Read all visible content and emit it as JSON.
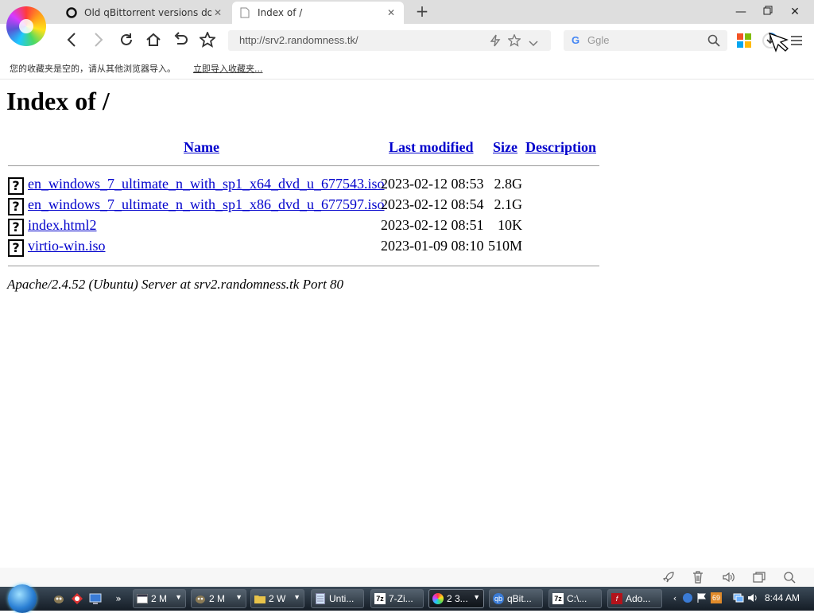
{
  "browser": {
    "tabs": [
      {
        "title": "Old qBittorrent versions down",
        "active": false
      },
      {
        "title": "Index of /",
        "active": true
      }
    ],
    "address_url": "http://srv2.randomness.tk/",
    "search_placeholder": "Ggle",
    "favorites_bar": {
      "message": "您的收藏夹是空的，请从其他浏览器导入。",
      "import_link": "立即导入收藏夹..."
    }
  },
  "page": {
    "title": "Index of /",
    "columns": {
      "name": "Name",
      "last_modified": "Last modified",
      "size": "Size",
      "description": "Description"
    },
    "files": [
      {
        "name": "en_windows_7_ultimate_n_with_sp1_x64_dvd_u_677543.iso",
        "modified": "2023-02-12 08:53",
        "size": "2.8G"
      },
      {
        "name": "en_windows_7_ultimate_n_with_sp1_x86_dvd_u_677597.iso",
        "modified": "2023-02-12 08:54",
        "size": "2.1G"
      },
      {
        "name": "index.html2",
        "modified": "2023-02-12 08:51",
        "size": "10K"
      },
      {
        "name": "virtio-win.iso",
        "modified": "2023-01-09 08:10",
        "size": "510M"
      }
    ],
    "server_signature": "Apache/2.4.52 (Ubuntu) Server at srv2.randomness.tk Port 80"
  },
  "taskbar": {
    "buttons": [
      {
        "label": "2 M",
        "icon": "window-icon"
      },
      {
        "label": "2 M",
        "icon": "gimp-icon"
      },
      {
        "label": "2 W",
        "icon": "folder-icon"
      },
      {
        "label": "Unti...",
        "icon": "notepad-icon"
      },
      {
        "label": "7-Zi...",
        "icon": "7zip-icon"
      },
      {
        "label": "2 3...",
        "icon": "browser-icon"
      },
      {
        "label": "qBit...",
        "icon": "qbittorrent-icon"
      },
      {
        "label": "C:\\...",
        "icon": "7zip-icon"
      },
      {
        "label": "Ado...",
        "icon": "flash-icon"
      }
    ],
    "tray_badge": "69",
    "clock": "8:44 AM"
  },
  "colors": {
    "link": "#0000cc",
    "tab_bar": "#dedede",
    "taskbar": "#1d2630"
  }
}
